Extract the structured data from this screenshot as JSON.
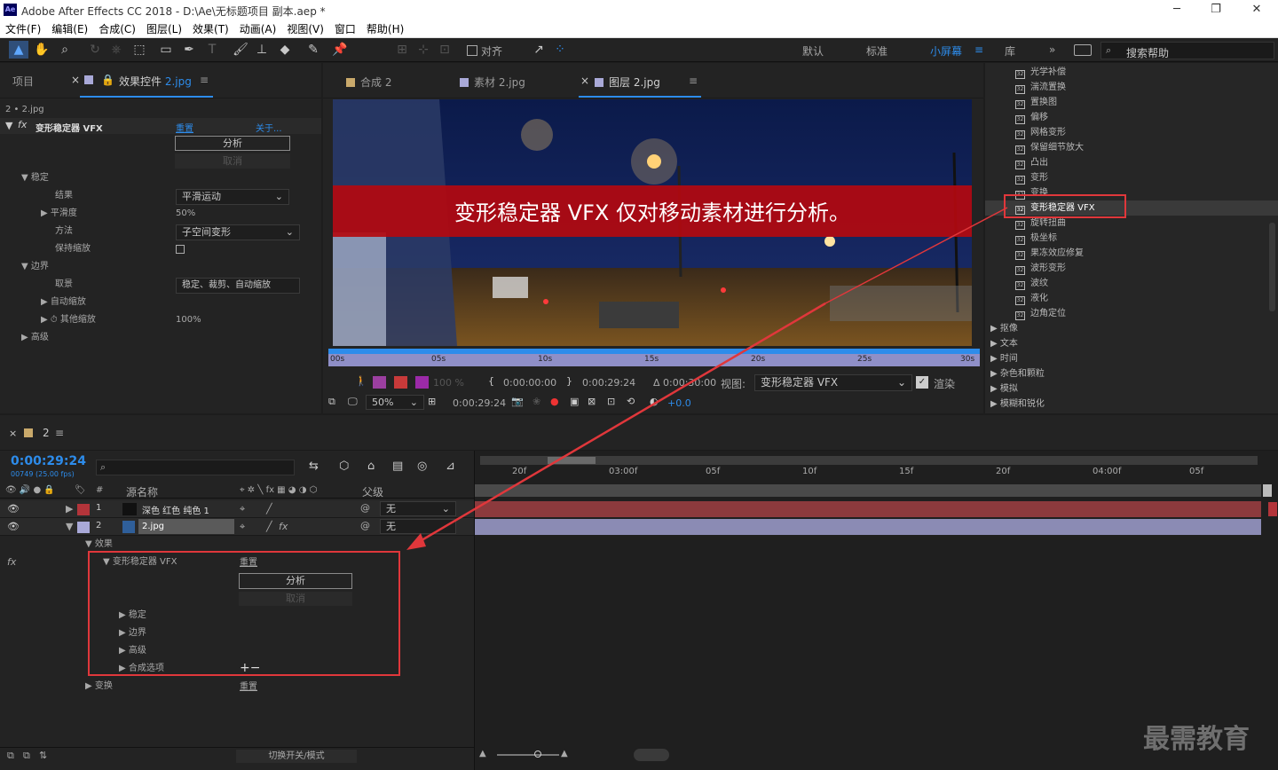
{
  "window": {
    "title": "Adobe After Effects CC 2018 - D:\\Ae\\无标题项目 副本.aep *",
    "icon": "Ae",
    "controls": [
      "─",
      "❐",
      "✕"
    ]
  },
  "menu": [
    "文件(F)",
    "编辑(E)",
    "合成(C)",
    "图层(L)",
    "效果(T)",
    "动画(A)",
    "视图(V)",
    "窗口",
    "帮助(H)"
  ],
  "toolbar": {
    "snap_label": "对齐",
    "workspaces": [
      "默认",
      "标准",
      "小屏幕",
      "库"
    ],
    "active_workspace": "小屏幕",
    "search_placeholder": "搜索帮助"
  },
  "left_panel": {
    "tabs": [
      "项目",
      "效果控件 2.jpg"
    ],
    "tab_effect_prefix": "效果控件",
    "tab_effect_file": "2.jpg",
    "layer_path": "2 • 2.jpg",
    "effect_name": "变形稳定器 VFX",
    "reset": "重置",
    "about": "关于...",
    "analyze": "分析",
    "cancel": "取消",
    "stabilize": "稳定",
    "result_label": "结果",
    "result_value": "平滑运动",
    "smooth_label": "平滑度",
    "smooth_value": "50%",
    "method_label": "方法",
    "method_value": "子空间变形",
    "keep_scale": "保持缩放",
    "borders": "边界",
    "framing_label": "取景",
    "framing_value": "稳定、裁剪、自动缩放",
    "auto_scale": "自动缩放",
    "other_scale_label": "其他缩放",
    "other_scale_value": "100%",
    "advanced": "高级"
  },
  "viewer": {
    "tabs": [
      "合成 2",
      "素材 2.jpg",
      "图层 2.jpg"
    ],
    "banner": "变形稳定器 VFX 仅对移动素材进行分析。",
    "ruler": [
      "00s",
      "05s",
      "10s",
      "15s",
      "20s",
      "25s",
      "30s"
    ],
    "opacity": "100 %",
    "time_in": "0:00:00:00",
    "time_out": "0:00:29:24",
    "duration": "Δ 0:00:30:00",
    "view_label": "视图:",
    "view_value": "变形稳定器 VFX",
    "render_label": "渲染",
    "zoom": "50%",
    "current_time": "0:00:29:24",
    "exposure": "+0.0"
  },
  "effects_list": {
    "items": [
      "光学补偿",
      "湍流置换",
      "置换图",
      "偏移",
      "网格变形",
      "保留细节放大",
      "凸出",
      "变形",
      "变换",
      "变形稳定器 VFX",
      "旋转扭曲",
      "极坐标",
      "果冻效应修复",
      "波形变形",
      "波纹",
      "液化",
      "边角定位"
    ],
    "highlight": "变形稳定器 VFX",
    "categories": [
      "抠像",
      "文本",
      "时间",
      "杂色和颗粒",
      "模拟",
      "模糊和锐化"
    ]
  },
  "timeline": {
    "comp_tab": "2",
    "timecode": "0:00:29:24",
    "frames": "00749 (25.00 fps)",
    "headers": {
      "num": "#",
      "source": "源名称",
      "parent": "父级"
    },
    "layers": [
      {
        "num": "1",
        "name": "深色 红色 纯色 1",
        "parent": "无",
        "color": "#b3343a"
      },
      {
        "num": "2",
        "name": "2.jpg",
        "parent": "无",
        "color": "#a9a9d8"
      }
    ],
    "effects_label": "效果",
    "fx_name": "变形稳定器 VFX",
    "fx_reset": "重置",
    "analyze": "分析",
    "cancel": "取消",
    "sub": [
      "稳定",
      "边界",
      "高级",
      "合成选项"
    ],
    "transform": "变换",
    "transform_reset": "重置",
    "ruler": [
      "20f",
      "03:00f",
      "05f",
      "10f",
      "15f",
      "20f",
      "04:00f",
      "05f"
    ],
    "toggle_modes": "切换开关/模式"
  },
  "watermark": "最需教育",
  "colors": {
    "accent": "#2d8ceb",
    "highlight_box": "#e0373b",
    "banner": "#b3090f"
  }
}
